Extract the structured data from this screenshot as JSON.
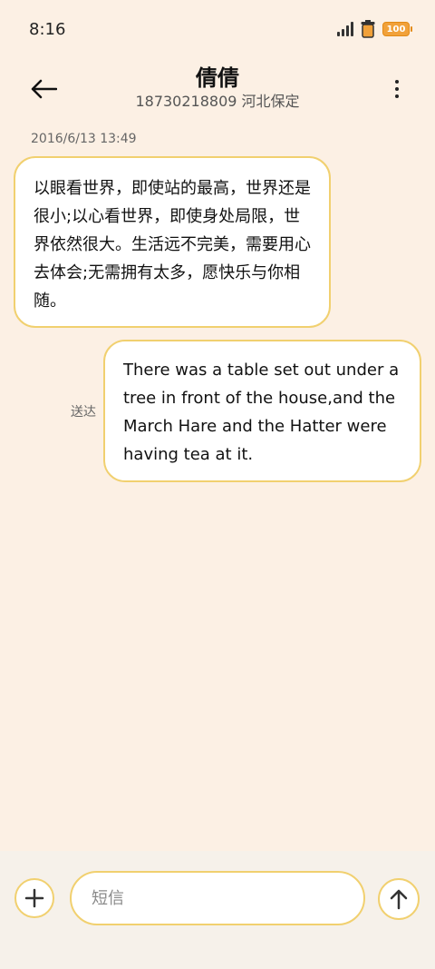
{
  "status_bar": {
    "time": "8:16",
    "battery": "100"
  },
  "header": {
    "title": "倩倩",
    "subtitle": "18730218809 河北保定"
  },
  "messages": {
    "timestamp": "2016/6/13 13:49",
    "incoming": {
      "text": "以眼看世界，即使站的最高，世界还是很小;以心看世界，即使身处局限，世界依然很大。生活远不完美，需要用心去体会;无需拥有太多，愿快乐与你相随。"
    },
    "outgoing": {
      "text": "There was a table set out under a tree in front of the house,and the March Hare and the Hatter were having tea at it.",
      "status": "送达"
    }
  },
  "composer": {
    "placeholder": "短信"
  },
  "colors": {
    "background": "#fcf0e4",
    "accent": "#f1d06f",
    "battery": "#f1a13a"
  }
}
